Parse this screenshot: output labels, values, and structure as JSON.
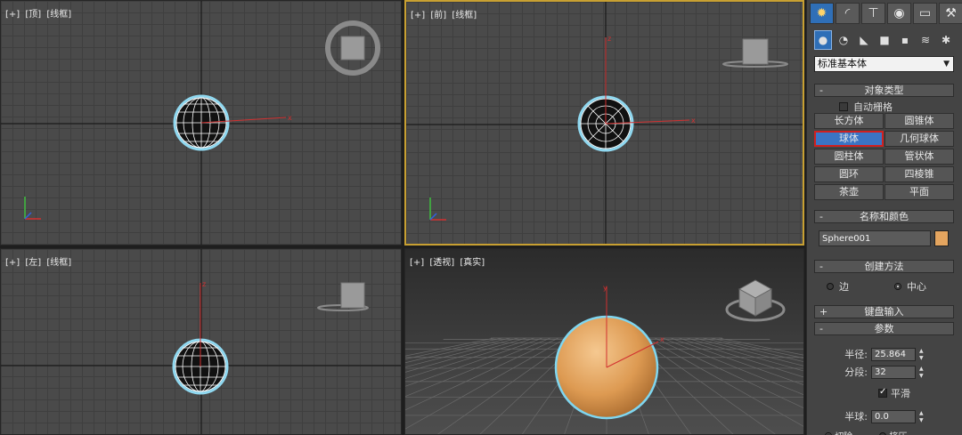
{
  "viewports": {
    "top": {
      "label": [
        "[+]",
        "[顶]",
        "[线框]"
      ]
    },
    "front": {
      "label": [
        "[+]",
        "[前]",
        "[线框]"
      ]
    },
    "left": {
      "label": [
        "[+]",
        "[左]",
        "[线框]"
      ]
    },
    "persp": {
      "label": [
        "[+]",
        "[透视]",
        "[真实]"
      ]
    }
  },
  "panel": {
    "main_tabs": [
      "create-icon",
      "modify-icon",
      "hierarchy-icon",
      "motion-icon",
      "display-icon",
      "utilities-icon"
    ],
    "sub_tabs": [
      "geometry-icon",
      "shapes-icon",
      "lights-icon",
      "cameras-icon",
      "helpers-icon",
      "spacewarps-icon",
      "systems-icon"
    ],
    "category_dropdown": "标准基本体",
    "object_type": {
      "header": "对象类型",
      "auto_grid": "自动栅格",
      "buttons": [
        "长方体",
        "圆锥体",
        "球体",
        "几何球体",
        "圆柱体",
        "管状体",
        "圆环",
        "四棱锥",
        "茶壶",
        "平面"
      ],
      "selected": "球体"
    },
    "name_color": {
      "header": "名称和颜色",
      "name": "Sphere001",
      "color": "#e4a55f"
    },
    "creation_method": {
      "header": "创建方法",
      "options": [
        "边",
        "中心"
      ],
      "selected": "中心"
    },
    "keyboard_entry": {
      "header": "键盘输入"
    },
    "parameters": {
      "header": "参数",
      "radius_label": "半径:",
      "radius": "25.864",
      "segments_label": "分段:",
      "segments": "32",
      "smooth_label": "平滑",
      "smooth": true,
      "hemisphere_label": "半球:",
      "hemisphere": "0.0",
      "chop_label": "切除",
      "squash_label": "挤压"
    }
  },
  "colors": {
    "active_viewport": "#c8a032",
    "selection": "#3a74c4",
    "sphere": "#e4a55f",
    "highlight": "#2f6fb7"
  }
}
